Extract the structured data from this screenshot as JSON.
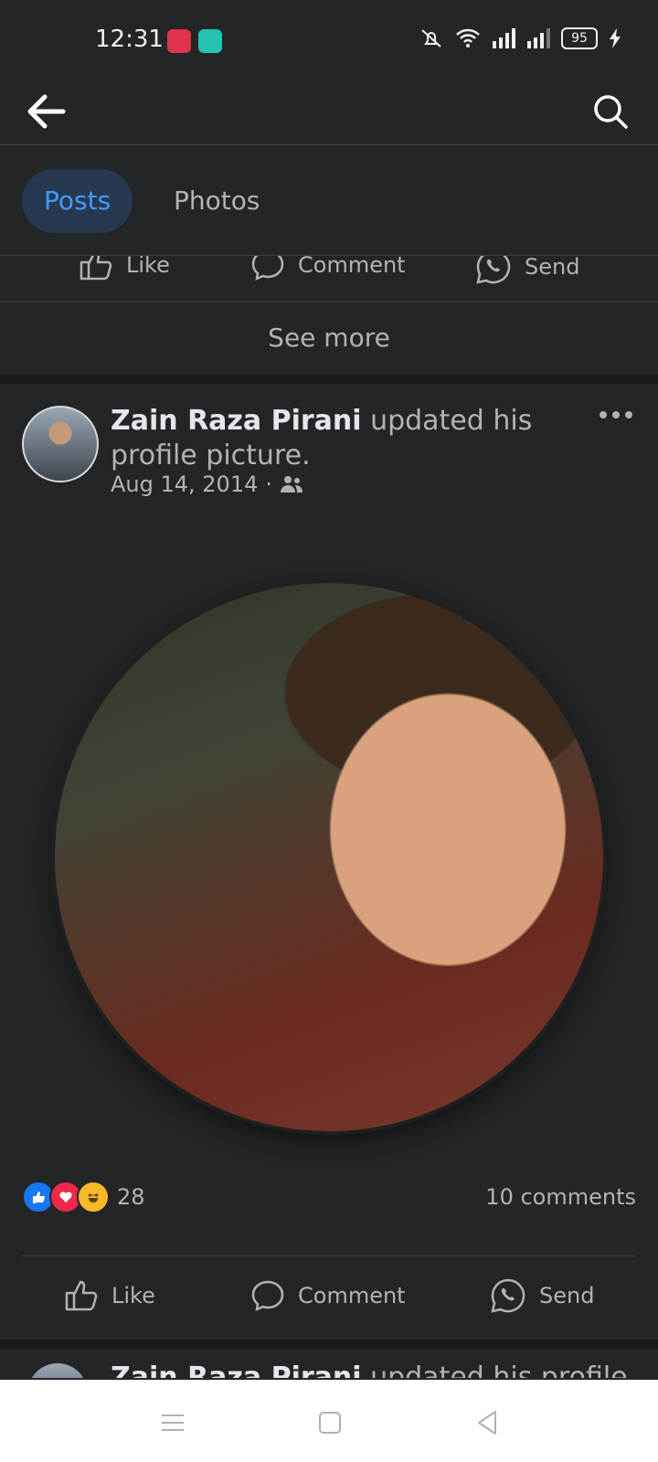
{
  "status_bar": {
    "time": "12:31",
    "battery": "95",
    "icons": [
      "mute-icon",
      "wifi-icon",
      "signal-icon",
      "signal-icon",
      "charging-icon"
    ]
  },
  "header": {
    "back_icon": "arrow-left-icon",
    "search_icon": "search-icon"
  },
  "tabs": [
    {
      "label": "Posts",
      "active": true
    },
    {
      "label": "Photos",
      "active": false
    }
  ],
  "prev_post_actions": {
    "like": "Like",
    "comment": "Comment",
    "send": "Send"
  },
  "see_more": "See more",
  "post": {
    "author": "Zain Raza Pirani",
    "action": "updated his profile picture.",
    "date": "Aug 14, 2014",
    "audience_icon": "friends-icon",
    "more_icon": "more-dots-icon",
    "reactions": [
      "like",
      "love",
      "haha"
    ],
    "reaction_count": "28",
    "comments": "10 comments",
    "actions": {
      "like": "Like",
      "comment": "Comment",
      "send": "Send"
    }
  },
  "next_post": {
    "author": "Zain Raza Pirani",
    "action": "updated his profile"
  },
  "colors": {
    "background": "#242526",
    "accent": "#4599ff",
    "active_tab_bg": "#263951"
  }
}
